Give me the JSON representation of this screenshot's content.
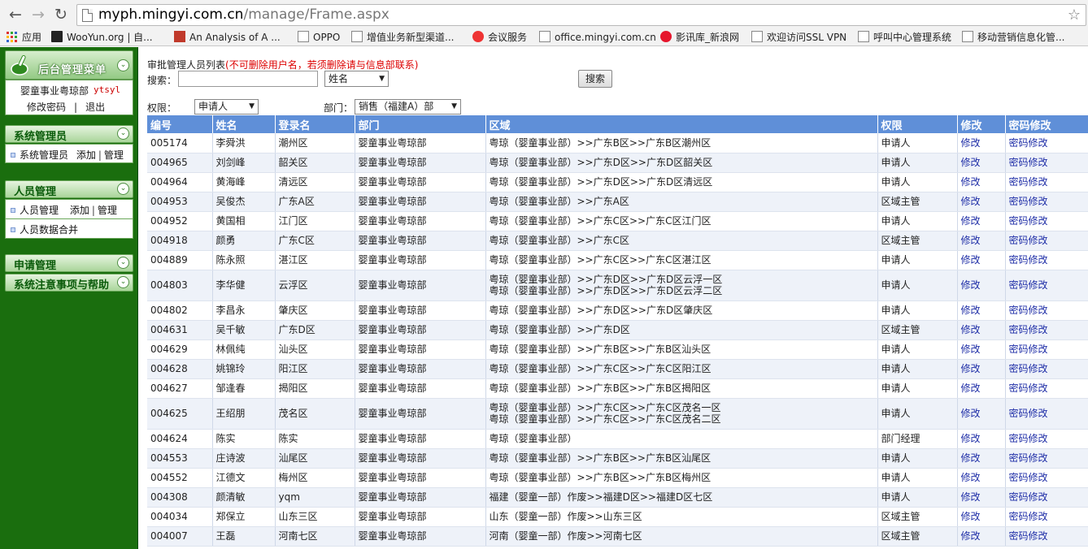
{
  "browser": {
    "url_host": "myph.mingyi.com.cn",
    "url_path": "/manage/Frame.aspx",
    "bookmarks": [
      {
        "label": "应用",
        "icon": "apps-icon"
      },
      {
        "label": "WooYun.org | 自...",
        "icon": "wooyun-icon"
      },
      {
        "label": "An Analysis of A ...",
        "icon": "tl-icon"
      },
      {
        "label": "OPPO",
        "icon": "page-icon"
      },
      {
        "label": "增值业务新型渠道...",
        "icon": "page-icon"
      },
      {
        "label": "会议服务",
        "icon": "opera-icon"
      },
      {
        "label": "office.mingyi.com.cn",
        "icon": "page-icon"
      },
      {
        "label": "影讯库_新浪网",
        "icon": "weibo-icon"
      },
      {
        "label": "欢迎访问SSL VPN",
        "icon": "page-icon"
      },
      {
        "label": "呼叫中心管理系统",
        "icon": "page-icon"
      },
      {
        "label": "移动营销信息化管...",
        "icon": "page-icon"
      }
    ]
  },
  "sidebar": {
    "title": "后台管理菜单",
    "user_dept": "婴童事业粤琼部",
    "user_id": "ytsyl",
    "change_password": "修改密码",
    "separator": "|",
    "logout": "退出",
    "panels": {
      "sysadmin": {
        "title": "系统管理员",
        "item": "系统管理员",
        "add": "添加",
        "manage": "管理"
      },
      "people": {
        "title": "人员管理",
        "item": "人员管理",
        "add": "添加",
        "manage": "管理",
        "merge": "人员数据合并"
      },
      "apply": {
        "title": "申请管理"
      },
      "help": {
        "title": "系统注意事项与帮助"
      }
    }
  },
  "main": {
    "title": "审批管理人员列表",
    "warning": "(不可删除用户名，若须删除请与信息部联系)",
    "search_label": "搜索：",
    "search_value": "",
    "search_field": "姓名",
    "search_button": "搜索",
    "perm_label": "权限：",
    "perm_value": "申请人",
    "dept_label": "部门：",
    "dept_value": "销售（福建A）部"
  },
  "table": {
    "headers": [
      "编号",
      "姓名",
      "登录名",
      "部门",
      "区域",
      "权限",
      "修改",
      "密码修改"
    ],
    "rows": [
      {
        "id": "005174",
        "name": "李舜洪",
        "login": "潮州区",
        "dept": "婴童事业粤琼部",
        "region": [
          "粤琼（婴童事业部）>>广东B区>>广东B区潮州区"
        ],
        "perm": "申请人",
        "edit": "修改",
        "pwd": "密码修改"
      },
      {
        "id": "004965",
        "name": "刘剑峰",
        "login": "韶关区",
        "dept": "婴童事业粤琼部",
        "region": [
          "粤琼（婴童事业部）>>广东D区>>广东D区韶关区"
        ],
        "perm": "申请人",
        "edit": "修改",
        "pwd": "密码修改"
      },
      {
        "id": "004964",
        "name": "黄海峰",
        "login": "清远区",
        "dept": "婴童事业粤琼部",
        "region": [
          "粤琼（婴童事业部）>>广东D区>>广东D区清远区"
        ],
        "perm": "申请人",
        "edit": "修改",
        "pwd": "密码修改"
      },
      {
        "id": "004953",
        "name": "吴俊杰",
        "login": "广东A区",
        "dept": "婴童事业粤琼部",
        "region": [
          "粤琼（婴童事业部）>>广东A区"
        ],
        "perm": "区域主管",
        "edit": "修改",
        "pwd": "密码修改"
      },
      {
        "id": "004952",
        "name": "黄国相",
        "login": "江门区",
        "dept": "婴童事业粤琼部",
        "region": [
          "粤琼（婴童事业部）>>广东C区>>广东C区江门区"
        ],
        "perm": "申请人",
        "edit": "修改",
        "pwd": "密码修改"
      },
      {
        "id": "004918",
        "name": "颜勇",
        "login": "广东C区",
        "dept": "婴童事业粤琼部",
        "region": [
          "粤琼（婴童事业部）>>广东C区"
        ],
        "perm": "区域主管",
        "edit": "修改",
        "pwd": "密码修改"
      },
      {
        "id": "004889",
        "name": "陈永照",
        "login": "湛江区",
        "dept": "婴童事业粤琼部",
        "region": [
          "粤琼（婴童事业部）>>广东C区>>广东C区湛江区"
        ],
        "perm": "申请人",
        "edit": "修改",
        "pwd": "密码修改"
      },
      {
        "id": "004803",
        "name": "李华健",
        "login": "云浮区",
        "dept": "婴童事业粤琼部",
        "region": [
          "粤琼（婴童事业部）>>广东D区>>广东D区云浮一区",
          "粤琼（婴童事业部）>>广东D区>>广东D区云浮二区"
        ],
        "perm": "申请人",
        "edit": "修改",
        "pwd": "密码修改"
      },
      {
        "id": "004802",
        "name": "李昌永",
        "login": "肇庆区",
        "dept": "婴童事业粤琼部",
        "region": [
          "粤琼（婴童事业部）>>广东D区>>广东D区肇庆区"
        ],
        "perm": "申请人",
        "edit": "修改",
        "pwd": "密码修改"
      },
      {
        "id": "004631",
        "name": "吴千敏",
        "login": "广东D区",
        "dept": "婴童事业粤琼部",
        "region": [
          "粤琼（婴童事业部）>>广东D区"
        ],
        "perm": "区域主管",
        "edit": "修改",
        "pwd": "密码修改"
      },
      {
        "id": "004629",
        "name": "林佩纯",
        "login": "汕头区",
        "dept": "婴童事业粤琼部",
        "region": [
          "粤琼（婴童事业部）>>广东B区>>广东B区汕头区"
        ],
        "perm": "申请人",
        "edit": "修改",
        "pwd": "密码修改"
      },
      {
        "id": "004628",
        "name": "姚锦玲",
        "login": "阳江区",
        "dept": "婴童事业粤琼部",
        "region": [
          "粤琼（婴童事业部）>>广东C区>>广东C区阳江区"
        ],
        "perm": "申请人",
        "edit": "修改",
        "pwd": "密码修改"
      },
      {
        "id": "004627",
        "name": "邹逢春",
        "login": "揭阳区",
        "dept": "婴童事业粤琼部",
        "region": [
          "粤琼（婴童事业部）>>广东B区>>广东B区揭阳区"
        ],
        "perm": "申请人",
        "edit": "修改",
        "pwd": "密码修改"
      },
      {
        "id": "004625",
        "name": "王绍朋",
        "login": "茂名区",
        "dept": "婴童事业粤琼部",
        "region": [
          "粤琼（婴童事业部）>>广东C区>>广东C区茂名一区",
          "粤琼（婴童事业部）>>广东C区>>广东C区茂名二区"
        ],
        "perm": "申请人",
        "edit": "修改",
        "pwd": "密码修改"
      },
      {
        "id": "004624",
        "name": "陈实",
        "login": "陈实",
        "dept": "婴童事业粤琼部",
        "region": [
          "粤琼（婴童事业部）"
        ],
        "perm": "部门经理",
        "edit": "修改",
        "pwd": "密码修改"
      },
      {
        "id": "004553",
        "name": "庄诗波",
        "login": "汕尾区",
        "dept": "婴童事业粤琼部",
        "region": [
          "粤琼（婴童事业部）>>广东B区>>广东B区汕尾区"
        ],
        "perm": "申请人",
        "edit": "修改",
        "pwd": "密码修改"
      },
      {
        "id": "004552",
        "name": "江德文",
        "login": "梅州区",
        "dept": "婴童事业粤琼部",
        "region": [
          "粤琼（婴童事业部）>>广东B区>>广东B区梅州区"
        ],
        "perm": "申请人",
        "edit": "修改",
        "pwd": "密码修改"
      },
      {
        "id": "004308",
        "name": "颜清敏",
        "login": "yqm",
        "dept": "婴童事业粤琼部",
        "region": [
          "福建（婴童一部）作废>>福建D区>>福建D区七区"
        ],
        "perm": "申请人",
        "edit": "修改",
        "pwd": "密码修改"
      },
      {
        "id": "004034",
        "name": "郑保立",
        "login": "山东三区",
        "dept": "婴童事业粤琼部",
        "region": [
          "山东（婴童一部）作废>>山东三区"
        ],
        "perm": "区域主管",
        "edit": "修改",
        "pwd": "密码修改"
      },
      {
        "id": "004007",
        "name": "王磊",
        "login": "河南七区",
        "dept": "婴童事业粤琼部",
        "region": [
          "河南（婴童一部）作废>>河南七区"
        ],
        "perm": "区域主管",
        "edit": "修改",
        "pwd": "密码修改"
      }
    ]
  },
  "colors": {
    "sidebar_bg": "#1a6e0e",
    "header_bg": "#5f8fd8",
    "link": "#1f2ea7",
    "warning": "#dd0000"
  }
}
